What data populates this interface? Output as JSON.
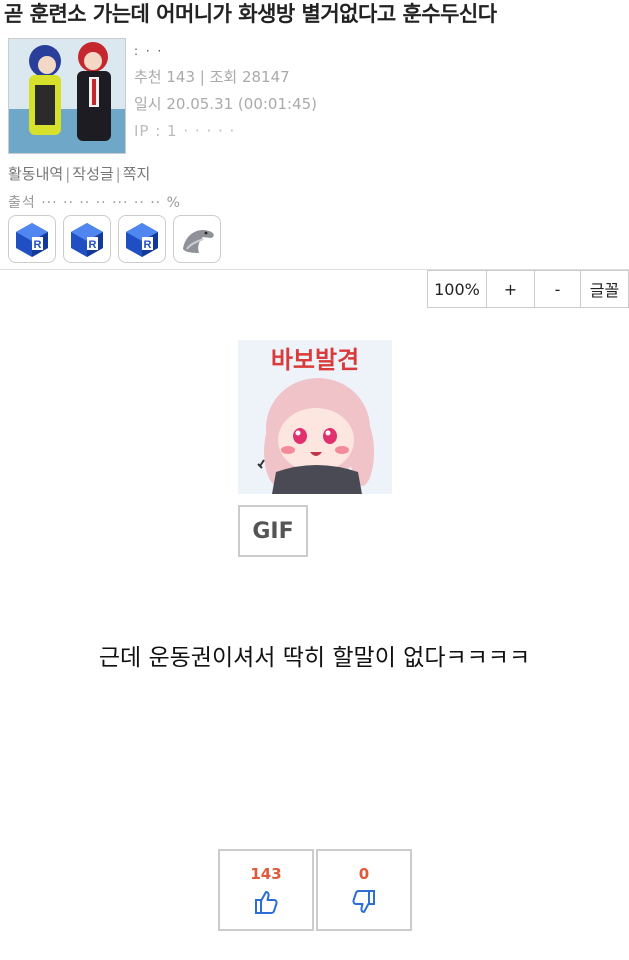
{
  "post": {
    "title": "곧 훈련소 가는데 어머니가 화생방 별거없다고 훈수두신다",
    "nickname": ":  ·  ·",
    "recommend": "추천 143 | 조회 28147",
    "date": "일시 20.05.31 (00:01:45)",
    "ip": "IP : 1 · · · · ·"
  },
  "links": {
    "activity": "활동내역",
    "posts": "작성글",
    "message": "쪽지"
  },
  "attendance": "출석 ··· ·· ·· ·· ··· ·· ·· %",
  "badges": [
    {
      "icon": "blue-cube-badge-icon"
    },
    {
      "icon": "blue-cube-badge-icon"
    },
    {
      "icon": "blue-cube-badge-icon"
    },
    {
      "icon": "dolphin-badge-icon"
    }
  ],
  "font_controls": {
    "zoom": "100%",
    "plus": "+",
    "minus": "-",
    "font": "글꼴"
  },
  "sticker": {
    "caption": "바보발견",
    "gif_label": "GIF"
  },
  "content": "근데 운동권이셔서 딱히 할말이 없다ㅋㅋㅋㅋ",
  "votes": {
    "up_count": "143",
    "down_count": "0"
  },
  "colors": {
    "vote_count": "#e05a3a",
    "thumb": "#2b6fd6",
    "badge_blue": "#1f4fc2"
  }
}
